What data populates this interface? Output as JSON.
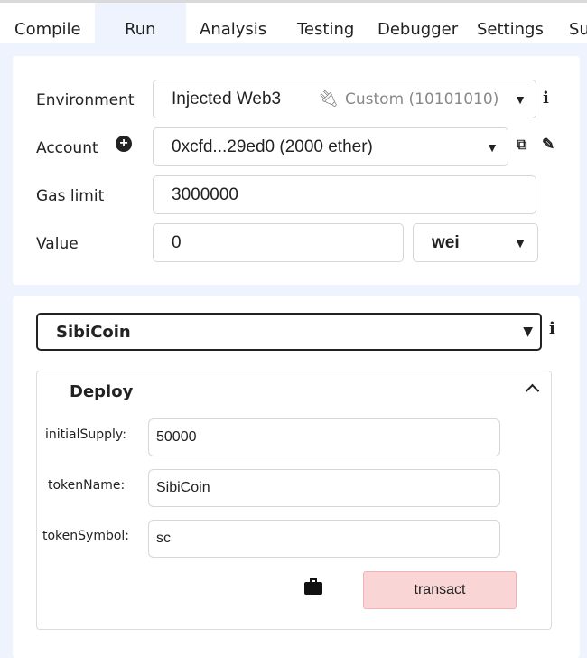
{
  "tabs": [
    "Compile",
    "Run",
    "Analysis",
    "Testing",
    "Debugger",
    "Settings",
    "Su"
  ],
  "env": {
    "label": "Environment",
    "value": "Injected Web3",
    "network": "Custom (10101010)"
  },
  "account": {
    "label": "Account",
    "value": "0xcfd...29ed0 (2000 ether)"
  },
  "gas": {
    "label": "Gas limit",
    "value": "3000000"
  },
  "value": {
    "label": "Value",
    "amount": "0",
    "unit": "wei"
  },
  "contract": {
    "selected": "SibiCoin"
  },
  "deploy": {
    "title": "Deploy",
    "params": [
      {
        "label": "initialSupply:",
        "value": "50000"
      },
      {
        "label": "tokenName:",
        "value": "SibiCoin"
      },
      {
        "label": "tokenSymbol:",
        "value": "sc"
      }
    ],
    "button": "transact"
  }
}
